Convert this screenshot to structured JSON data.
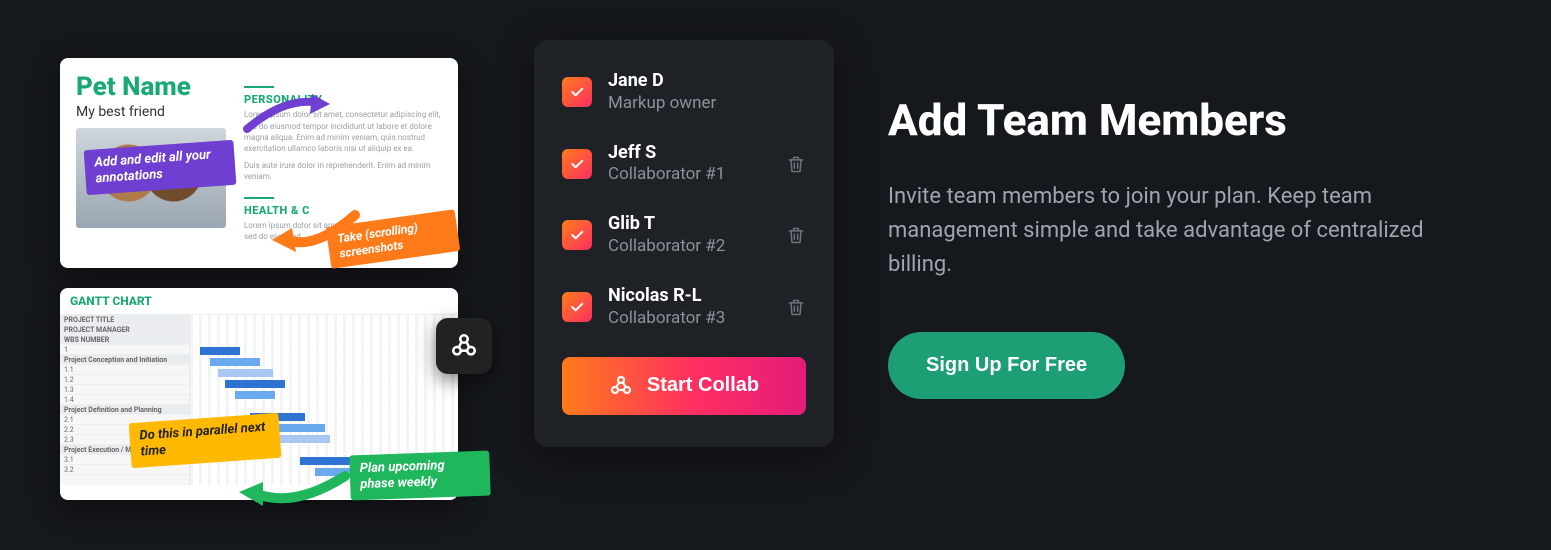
{
  "illustration": {
    "pet_card": {
      "title": "Pet Name",
      "subtitle": "My best friend",
      "section1": "PERSONALITY",
      "section2": "HEALTH & C",
      "lorem1": "Lorem ipsum dolor sit amet, consectetur adipiscing elit, sed do eiusmod tempor incididunt ut labore et dolore magna aliqua. Enim ad minim veniam, quis nostrud exercitation ullamco laboris nisi ut aliquip ex ea.",
      "lorem2": "Duis aute irure dolor in reprehenderit. Enim ad minim veniam.",
      "lorem3": "Lorem ipsum dolor sit amet, consectetur adipiscing elit, sed do eiusmod.",
      "anno_purple": "Add and edit all your annotations",
      "anno_orange": "Take (scrolling) screenshots"
    },
    "gantt_card": {
      "title": "GANTT CHART",
      "anno_yellow": "Do this in parallel next time",
      "anno_green": "Plan upcoming phase weekly",
      "rows": [
        "PROJECT TITLE",
        "PROJECT MANAGER",
        "WBS NUMBER",
        "1",
        "Project Conception and Initiation",
        "1.1",
        "1.2",
        "1.3",
        "1.4",
        "Project Definition and Planning",
        "2.1",
        "2.2",
        "2.3",
        "Project Execution / Monitoring",
        "3.1",
        "3.2"
      ]
    }
  },
  "panel": {
    "members": [
      {
        "name": "Jane D",
        "role": "Markup owner",
        "deletable": false
      },
      {
        "name": "Jeff S",
        "role": "Collaborator #1",
        "deletable": true
      },
      {
        "name": "Glib T",
        "role": "Collaborator #2",
        "deletable": true
      },
      {
        "name": "Nicolas R-L",
        "role": "Collaborator #3",
        "deletable": true
      }
    ],
    "button": "Start Collab"
  },
  "right": {
    "headline": "Add Team Members",
    "description": "Invite team members to join your plan. Keep team management simple and take advantage of centralized billing.",
    "cta": "Sign Up For Free"
  },
  "colors": {
    "bg": "#15181c",
    "panel": "#1e2227",
    "accent_green": "#1d9e74",
    "gradient_start": "#ff7b1a",
    "gradient_end": "#ff2e63"
  }
}
